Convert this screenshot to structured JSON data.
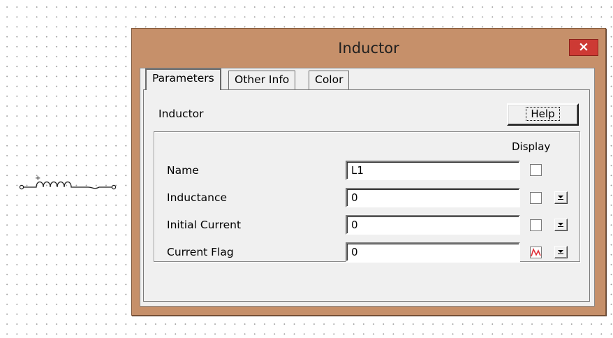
{
  "dialog": {
    "title": "Inductor",
    "close_label": "×"
  },
  "tabs": [
    {
      "label": "Parameters",
      "active": true
    },
    {
      "label": "Other Info",
      "active": false
    },
    {
      "label": "Color",
      "active": false
    }
  ],
  "pane": {
    "component_label": "Inductor",
    "help_label": "Help",
    "display_header": "Display"
  },
  "rows": [
    {
      "label": "Name",
      "value": "L1",
      "display_checked": false,
      "has_dropdown": false
    },
    {
      "label": "Inductance",
      "value": "0",
      "display_checked": false,
      "has_dropdown": true
    },
    {
      "label": "Initial Current",
      "value": "0",
      "display_checked": false,
      "has_dropdown": true
    },
    {
      "label": "Current Flag",
      "value": "0",
      "display_checked": false,
      "has_dropdown": true,
      "flag_icon": "waveform-icon"
    }
  ],
  "colors": {
    "dialog_frame": "#c6906a",
    "close_button": "#cd3a34",
    "flag_icon": "#e0303a"
  }
}
